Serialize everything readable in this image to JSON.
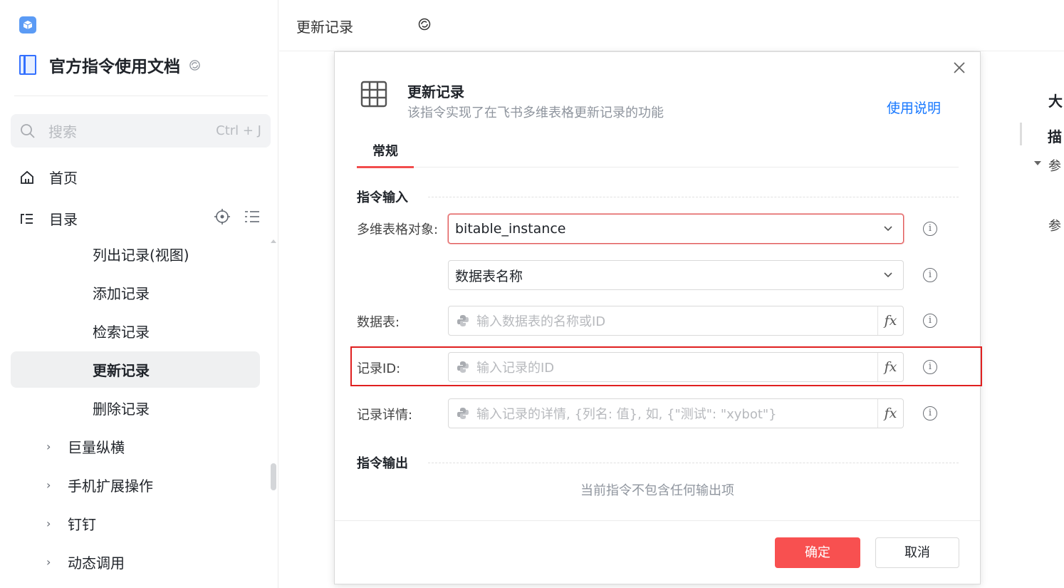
{
  "sidebar": {
    "doc_title": "官方指令使用文档",
    "search": {
      "placeholder": "搜索",
      "shortcut": "Ctrl + J"
    },
    "home_label": "首页",
    "toc_label": "目录",
    "children": [
      "列出记录(视图)",
      "添加记录",
      "检索记录",
      "更新记录",
      "删除记录"
    ],
    "active_child": "更新记录",
    "groups": [
      "巨量纵横",
      "手机扩展操作",
      "钉钉",
      "动态调用"
    ]
  },
  "header": {
    "page_tab": "更新记录"
  },
  "outline": {
    "title": "大",
    "item1": "描",
    "item2": "参",
    "item3": "参"
  },
  "dialog": {
    "title": "更新记录",
    "description": "该指令实现了在飞书多维表格更新记录的功能",
    "help_link": "使用说明",
    "tab": "常规",
    "input_section": "指令输入",
    "output_section": "指令输出",
    "fields": {
      "bitable_label": "多维表格对象:",
      "bitable_value": "bitable_instance",
      "table_mode_value": "数据表名称",
      "table_label": "数据表:",
      "table_placeholder": "输入数据表的名称或ID",
      "record_id_label": "记录ID:",
      "record_id_placeholder": "输入记录的ID",
      "record_detail_label": "记录详情:",
      "record_detail_placeholder": "输入记录的详情, {列名: 值}, 如, {\"测试\": \"xybot\"}"
    },
    "fx_label": "fx",
    "info_glyph": "i",
    "no_output": "当前指令不包含任何输出项",
    "ok_button": "确定",
    "cancel_button": "取消"
  },
  "colors": {
    "accent_red": "#f85050",
    "link_blue": "#1677ff",
    "highlight_red": "#e02020"
  }
}
